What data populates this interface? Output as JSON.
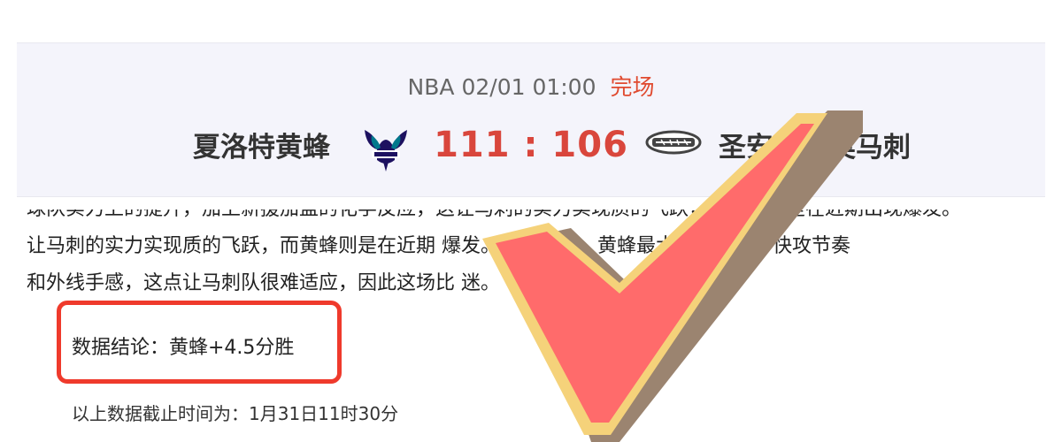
{
  "match": {
    "league": "NBA",
    "datetime": "02/01 01:00",
    "status": "完场",
    "home_team": "夏洛特黄蜂",
    "away_team": "圣安东尼奥马刺",
    "score": "111 : 106",
    "home_logo_icon": "hornets-logo-icon",
    "away_logo_icon": "spurs-logo-icon"
  },
  "article": {
    "line0": "球队实力上的提升，加上新援加盟的化学反应，这让马刺的实力实现质的飞跃，而黄蜂则是在近期出现爆发。",
    "line1": "让马刺的实力实现质的飞跃，而黄蜂则是在近期                爆发。目前来看，黄蜂最大的优势在于快攻节奏",
    "line2": "和外线手感，这点让马刺队很难适应，因此这场比                      迷。"
  },
  "conclusion": "数据结论：黄蜂+4.5分胜",
  "cutoff_note": "以上数据截止时间为：1月31日11时30分",
  "colors": {
    "status": "#e04a2f",
    "score": "#d9463c",
    "box": "#ef3a2c",
    "check_fill": "#ff6b6b",
    "check_outline": "#f5d27a",
    "check_shadow": "#9b8470"
  }
}
